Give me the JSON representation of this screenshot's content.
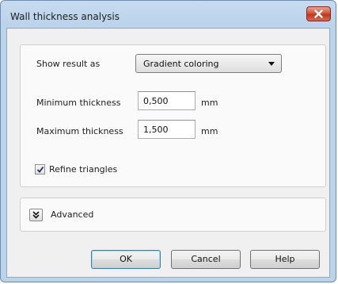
{
  "window": {
    "title": "Wall thickness analysis"
  },
  "show_result": {
    "label": "Show result as",
    "selected": "Gradient coloring"
  },
  "minimum_thickness": {
    "label": "Minimum thickness",
    "value": "0,500",
    "unit": "mm"
  },
  "maximum_thickness": {
    "label": "Maximum thickness",
    "value": "1,500",
    "unit": "mm"
  },
  "refine_triangles": {
    "label": "Refine triangles",
    "checked": true
  },
  "advanced": {
    "label": "Advanced",
    "icon": "double-chevron-down-icon"
  },
  "buttons": {
    "ok": "OK",
    "cancel": "Cancel",
    "help": "Help"
  },
  "colors": {
    "title_bar": "#bcd3ec",
    "close_button": "#c9452b",
    "dialog_background": "#f0f0f0",
    "default_button_border": "#3c7fb1"
  }
}
